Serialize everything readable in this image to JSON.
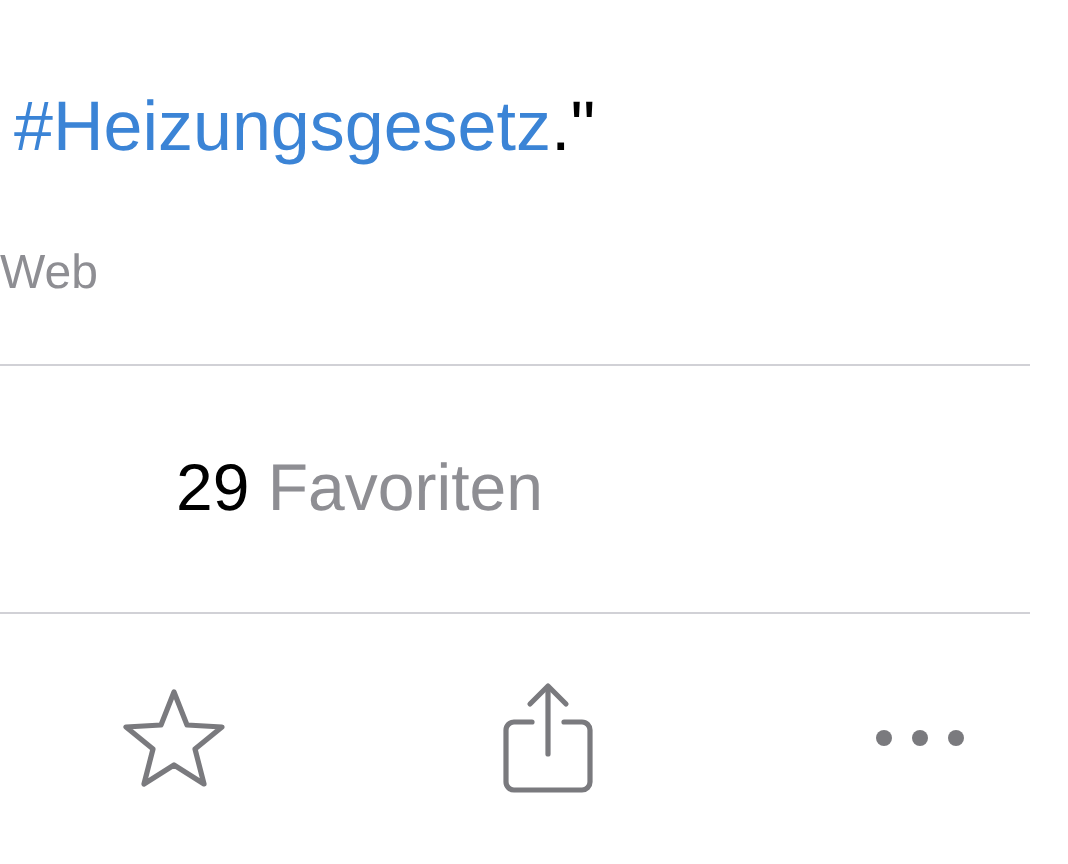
{
  "tweet_text": {
    "hashtag": "#Heizungsgesetz",
    "trailing": ".\""
  },
  "source": "Web",
  "stats": {
    "count": "29",
    "label": "Favoriten"
  },
  "actions": [
    {
      "kind": "favorite"
    },
    {
      "kind": "share"
    },
    {
      "kind": "more"
    }
  ]
}
